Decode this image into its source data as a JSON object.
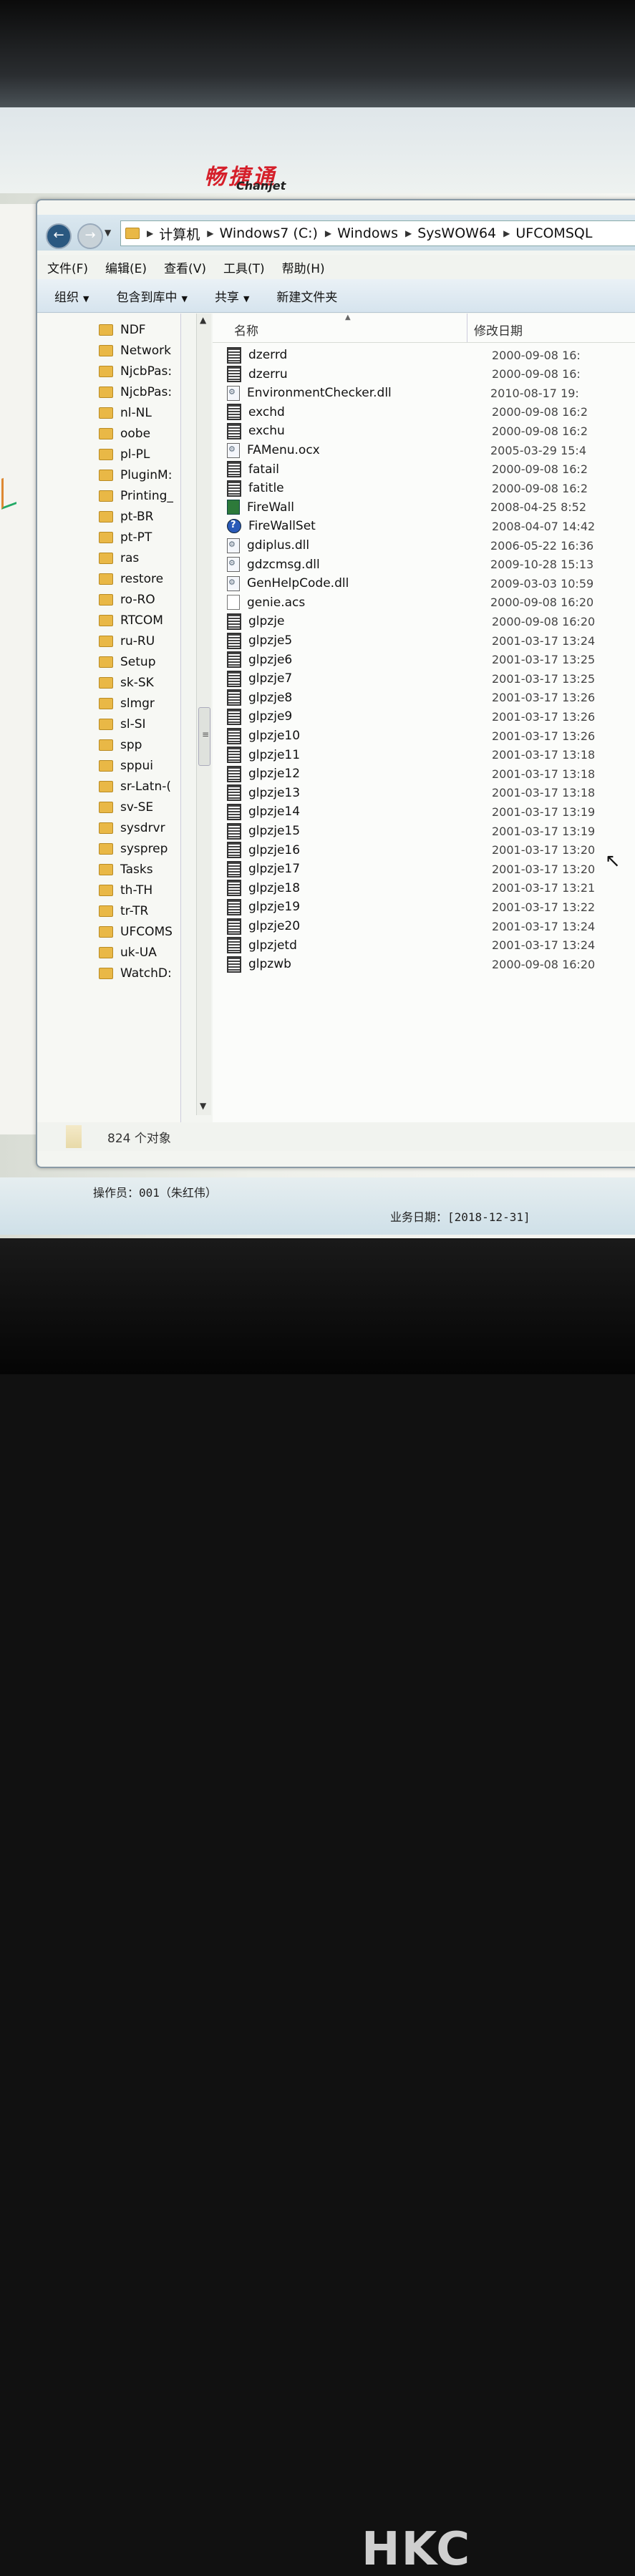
{
  "app": {
    "logo_text": "畅捷通",
    "logo_sub": "Chanjet"
  },
  "address_bar": {
    "crumbs": [
      "计算机",
      "Windows7 (C:)",
      "Windows",
      "SysWOW64",
      "UFCOMSQL"
    ]
  },
  "menu": [
    "文件(F)",
    "编辑(E)",
    "查看(V)",
    "工具(T)",
    "帮助(H)"
  ],
  "toolbar": {
    "organize": "组织",
    "include_library": "包含到库中",
    "share": "共享",
    "new_folder": "新建文件夹"
  },
  "nav_items": [
    "NDF",
    "Network",
    "NjcbPas:",
    "NjcbPas:",
    "nl-NL",
    "oobe",
    "pl-PL",
    "PluginM:",
    "Printing_",
    "pt-BR",
    "pt-PT",
    "ras",
    "restore",
    "ro-RO",
    "RTCOM",
    "ru-RU",
    "Setup",
    "sk-SK",
    "slmgr",
    "sl-SI",
    "spp",
    "sppui",
    "sr-Latn-(",
    "sv-SE",
    "sysdrvr",
    "sysprep",
    "Tasks",
    "th-TH",
    "tr-TR",
    "UFCOMS",
    "uk-UA",
    "WatchD:"
  ],
  "columns": {
    "name": "名称",
    "date": "修改日期"
  },
  "files": [
    {
      "name": "dzerrd",
      "date": "2000-09-08 16:",
      "icon": "doc"
    },
    {
      "name": "dzerru",
      "date": "2000-09-08 16:",
      "icon": "doc"
    },
    {
      "name": "EnvironmentChecker.dll",
      "date": "2010-08-17 19:",
      "icon": "dll"
    },
    {
      "name": "exchd",
      "date": "2000-09-08 16:2",
      "icon": "doc"
    },
    {
      "name": "exchu",
      "date": "2000-09-08 16:2",
      "icon": "doc"
    },
    {
      "name": "FAMenu.ocx",
      "date": "2005-03-29 15:4",
      "icon": "dll"
    },
    {
      "name": "fatail",
      "date": "2000-09-08 16:2",
      "icon": "doc"
    },
    {
      "name": "fatitle",
      "date": "2000-09-08 16:2",
      "icon": "doc"
    },
    {
      "name": "FireWall",
      "date": "2008-04-25 8:52",
      "icon": "exe"
    },
    {
      "name": "FireWallSet",
      "date": "2008-04-07 14:42",
      "icon": "help"
    },
    {
      "name": "gdiplus.dll",
      "date": "2006-05-22 16:36",
      "icon": "dll"
    },
    {
      "name": "gdzcmsg.dll",
      "date": "2009-10-28 15:13",
      "icon": "dll"
    },
    {
      "name": "GenHelpCode.dll",
      "date": "2009-03-03 10:59",
      "icon": "dll"
    },
    {
      "name": "genie.acs",
      "date": "2000-09-08 16:20",
      "icon": "blank"
    },
    {
      "name": "glpzje",
      "date": "2000-09-08 16:20",
      "icon": "doc"
    },
    {
      "name": "glpzje5",
      "date": "2001-03-17 13:24",
      "icon": "doc"
    },
    {
      "name": "glpzje6",
      "date": "2001-03-17 13:25",
      "icon": "doc"
    },
    {
      "name": "glpzje7",
      "date": "2001-03-17 13:25",
      "icon": "doc"
    },
    {
      "name": "glpzje8",
      "date": "2001-03-17 13:26",
      "icon": "doc"
    },
    {
      "name": "glpzje9",
      "date": "2001-03-17 13:26",
      "icon": "doc"
    },
    {
      "name": "glpzje10",
      "date": "2001-03-17 13:26",
      "icon": "doc"
    },
    {
      "name": "glpzje11",
      "date": "2001-03-17 13:18",
      "icon": "doc"
    },
    {
      "name": "glpzje12",
      "date": "2001-03-17 13:18",
      "icon": "doc"
    },
    {
      "name": "glpzje13",
      "date": "2001-03-17 13:18",
      "icon": "doc"
    },
    {
      "name": "glpzje14",
      "date": "2001-03-17 13:19",
      "icon": "doc"
    },
    {
      "name": "glpzje15",
      "date": "2001-03-17 13:19",
      "icon": "doc"
    },
    {
      "name": "glpzje16",
      "date": "2001-03-17 13:20",
      "icon": "doc"
    },
    {
      "name": "glpzje17",
      "date": "2001-03-17 13:20",
      "icon": "doc"
    },
    {
      "name": "glpzje18",
      "date": "2001-03-17 13:21",
      "icon": "doc"
    },
    {
      "name": "glpzje19",
      "date": "2001-03-17 13:22",
      "icon": "doc"
    },
    {
      "name": "glpzje20",
      "date": "2001-03-17 13:24",
      "icon": "doc"
    },
    {
      "name": "glpzjetd",
      "date": "2001-03-17 13:24",
      "icon": "doc"
    },
    {
      "name": "glpzwb",
      "date": "2000-09-08 16:20",
      "icon": "doc"
    }
  ],
  "status": {
    "count": "824 个对象"
  },
  "app_status": {
    "operator": "操作员：001（朱红伟）",
    "business_date": "业务日期：[2018-12-31]"
  },
  "monitor_brand": "HKC"
}
